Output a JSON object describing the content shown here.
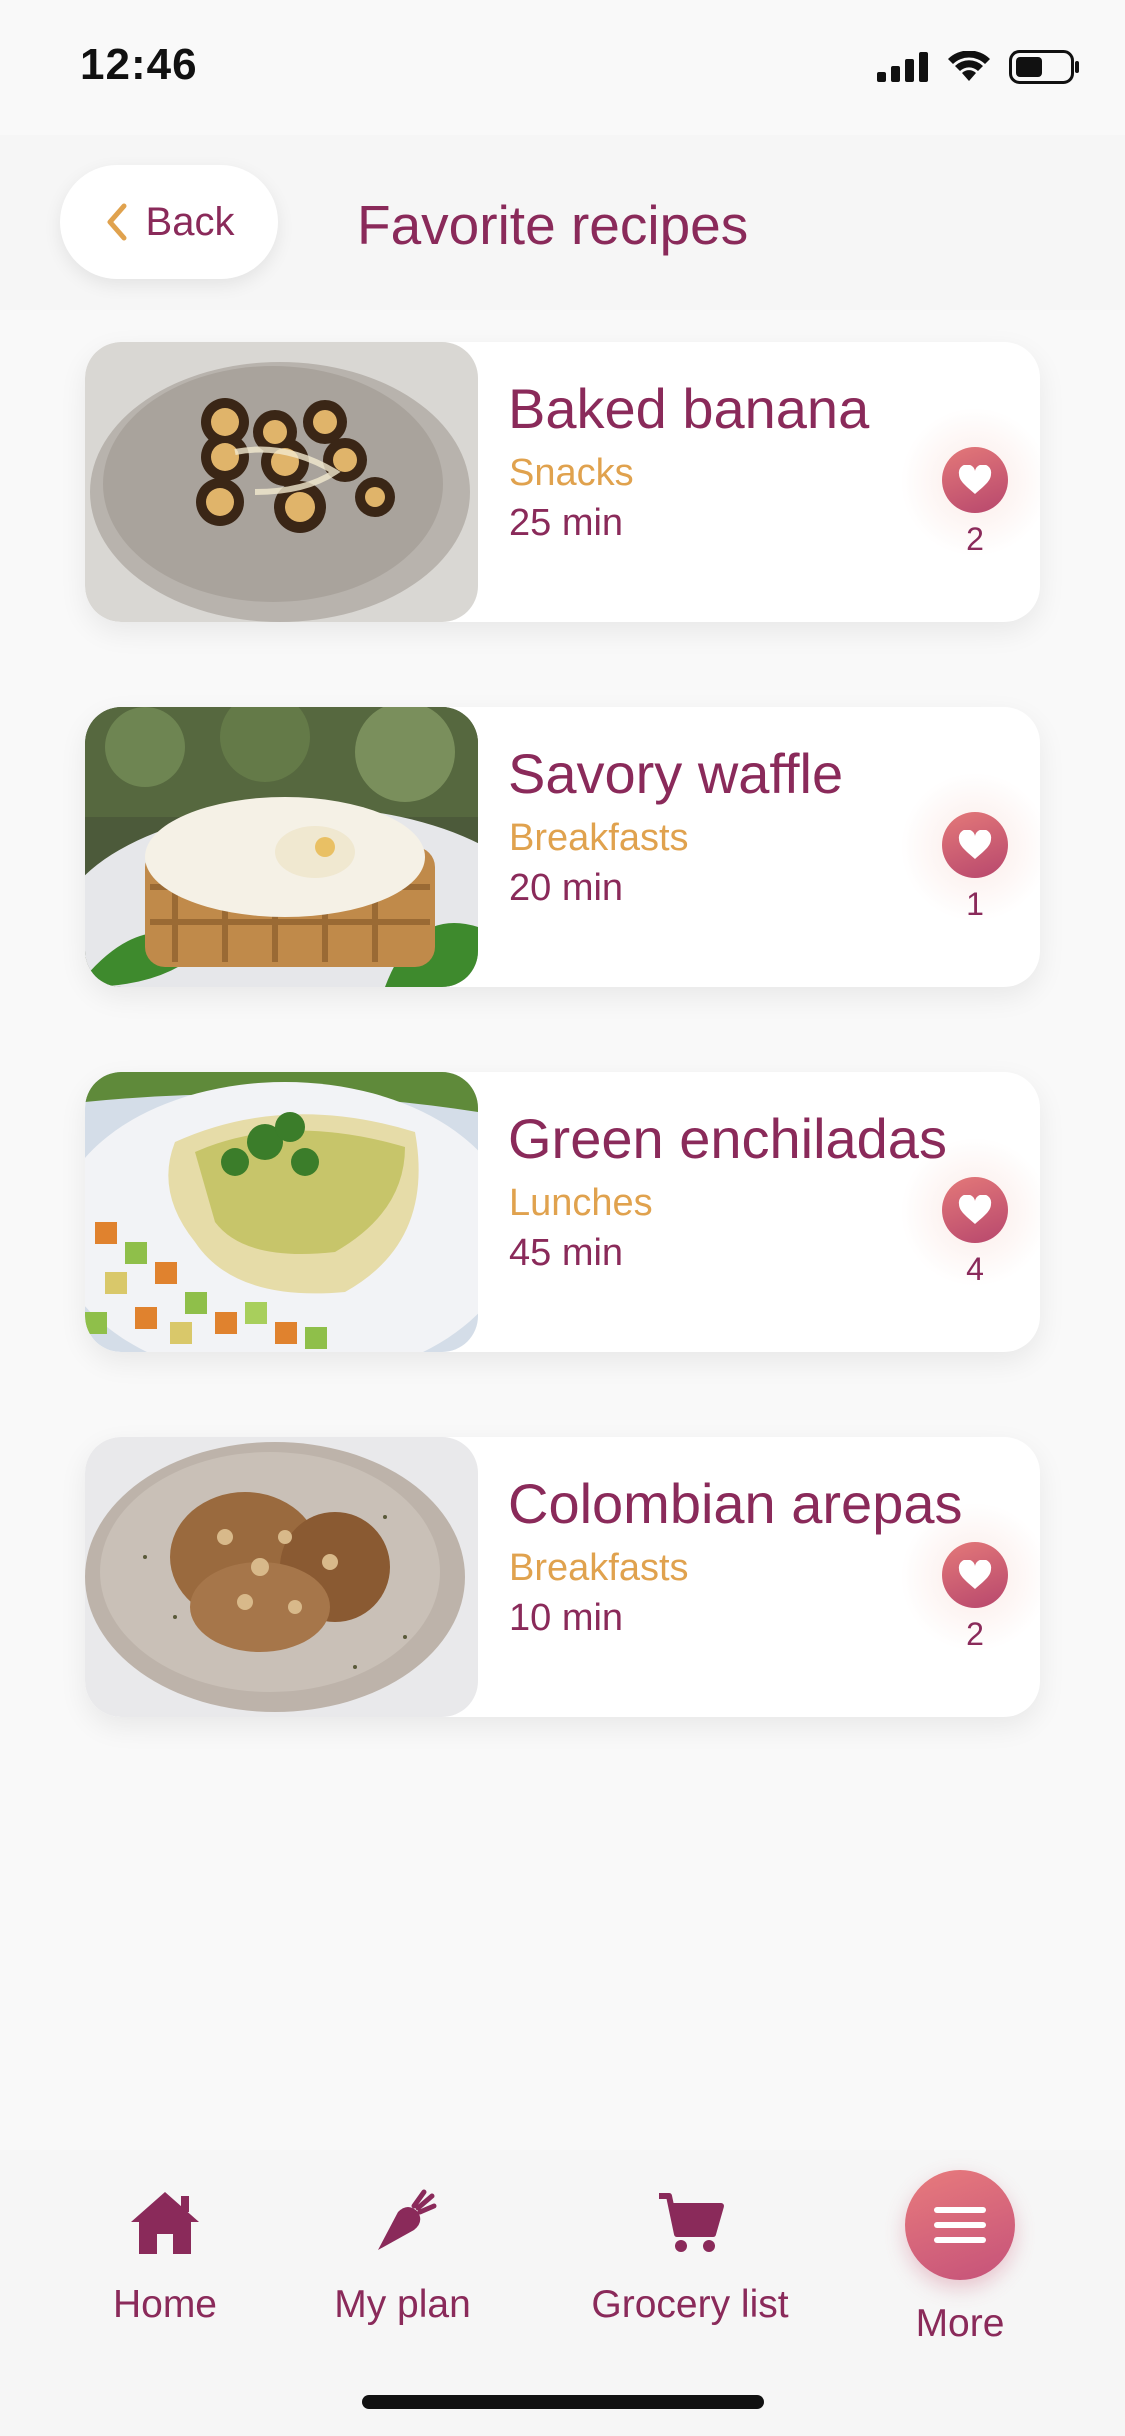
{
  "status_bar": {
    "time": "12:46"
  },
  "header": {
    "back_label": "Back",
    "title": "Favorite recipes"
  },
  "recipes": [
    {
      "title": "Baked banana",
      "category": "Snacks",
      "time": "25 min",
      "favorites": "2",
      "image": "baked-banana-photo"
    },
    {
      "title": "Savory waffle",
      "category": "Breakfasts",
      "time": "20 min",
      "favorites": "1",
      "image": "savory-waffle-photo"
    },
    {
      "title": "Green enchiladas",
      "category": "Lunches",
      "time": "45 min",
      "favorites": "4",
      "image": "green-enchiladas-photo"
    },
    {
      "title": "Colombian arepas",
      "category": "Breakfasts",
      "time": "10 min",
      "favorites": "2",
      "image": "colombian-arepas-photo"
    }
  ],
  "tab_bar": {
    "items": [
      {
        "label": "Home",
        "icon": "home-icon"
      },
      {
        "label": "My plan",
        "icon": "carrot-icon"
      },
      {
        "label": "Grocery list",
        "icon": "cart-icon"
      },
      {
        "label": "More",
        "icon": "menu-icon"
      }
    ]
  },
  "colors": {
    "accent": "#8a2a5a",
    "category": "#e0a24e",
    "heart_gradient_start": "#e47979",
    "heart_gradient_end": "#b7476d"
  }
}
